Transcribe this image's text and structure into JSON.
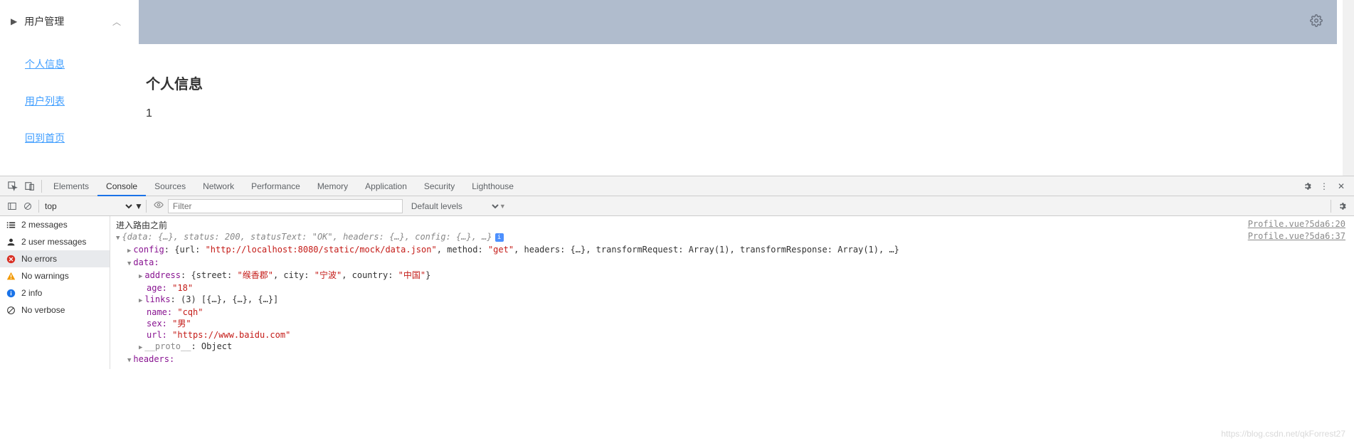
{
  "sidebar": {
    "header": "用户管理",
    "items": [
      {
        "label": "个人信息"
      },
      {
        "label": "用户列表"
      },
      {
        "label": "回到首页"
      }
    ]
  },
  "content": {
    "title": "个人信息",
    "id_value": "1"
  },
  "devtools": {
    "tabs": [
      "Elements",
      "Console",
      "Sources",
      "Network",
      "Performance",
      "Memory",
      "Application",
      "Security",
      "Lighthouse"
    ],
    "active_tab": "Console",
    "context": "top",
    "filter_placeholder": "Filter",
    "levels": "Default levels",
    "side": {
      "messages": "2 messages",
      "user_messages": "2 user messages",
      "errors": "No errors",
      "warnings": "No warnings",
      "info": "2 info",
      "verbose": "No verbose"
    },
    "console": {
      "row1_msg": "进入路由之前",
      "row1_src": "Profile.vue?5da6:20",
      "row2_summary": "{data: {…}, status: 200, statusText: \"OK\", headers: {…}, config: {…}, …}",
      "row2_src": "Profile.vue?5da6:37",
      "config_line": "config: {url: \"http://localhost:8080/static/mock/data.json\", method: \"get\", headers: {…}, transformRequest: Array(1), transformResponse: Array(1), …}",
      "data_label": "data:",
      "address": {
        "label": "address:",
        "street_key": "street:",
        "street_val": "\"缑香郡\"",
        "city_key": "city:",
        "city_val": "\"宁波\"",
        "country_key": "country:",
        "country_val": "\"中国\""
      },
      "age_key": "age:",
      "age_val": "\"18\"",
      "links": "links: (3) [{…}, {…}, {…}]",
      "name_key": "name:",
      "name_val": "\"cqh\"",
      "sex_key": "sex:",
      "sex_val": "\"男\"",
      "url_key": "url:",
      "url_val": "\"https://www.baidu.com\"",
      "proto": "__proto__: Object",
      "headers_label": "headers:"
    }
  },
  "watermark": "https://blog.csdn.net/qkForrest27"
}
